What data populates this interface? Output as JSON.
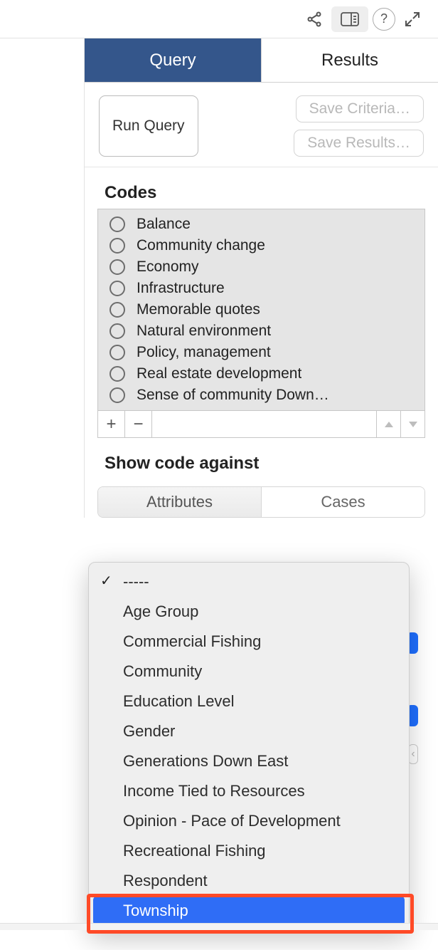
{
  "toolbar": {
    "share_icon": "share",
    "panel_icon": "panel",
    "help_icon": "?",
    "expand_icon": "expand"
  },
  "tabs": {
    "query": "Query",
    "results": "Results",
    "active": "query"
  },
  "actions": {
    "run_query": "Run Query",
    "save_criteria": "Save Criteria…",
    "save_results": "Save Results…"
  },
  "codes": {
    "heading": "Codes",
    "items": [
      "Balance",
      "Community change",
      "Economy",
      "Infrastructure",
      "Memorable quotes",
      "Natural environment",
      "Policy, management",
      "Real estate development",
      "Sense of community Down…"
    ],
    "footer": {
      "add": "+",
      "remove": "−"
    }
  },
  "show_against": {
    "heading": "Show code against",
    "tabs": {
      "attributes": "Attributes",
      "cases": "Cases",
      "active": "attributes"
    }
  },
  "dropdown": {
    "selected": "-----",
    "items": [
      "-----",
      "Age Group",
      "Commercial Fishing",
      "Community",
      "Education Level",
      "Gender",
      "Generations Down East",
      "Income Tied to Resources",
      "Opinion - Pace of Development",
      "Recreational Fishing",
      "Respondent",
      "Township"
    ],
    "highlighted": "Township"
  }
}
